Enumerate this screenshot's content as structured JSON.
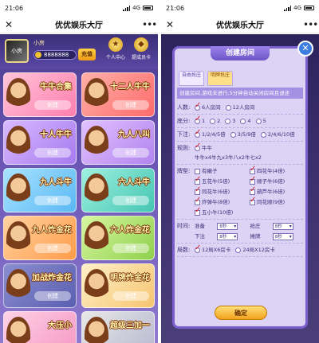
{
  "status_bar": {
    "time": "21:06",
    "network": "4G"
  },
  "wechat": {
    "close_icon": "close-icon",
    "title": "优优娱乐大厅",
    "more_icon": "more-icon"
  },
  "left": {
    "user": {
      "name": "小房",
      "avatar_text": "小房",
      "coins": "8888888",
      "recharge_label": "充值"
    },
    "top_icons": [
      {
        "icon": "trophy-icon",
        "label": "个人中心"
      },
      {
        "icon": "bag-icon",
        "label": "提成员卡"
      }
    ],
    "games": [
      {
        "name": "牛牛合集",
        "btn": "创建",
        "color": "c-pink"
      },
      {
        "name": "十二人牛牛",
        "btn": "创建",
        "color": "c-red"
      },
      {
        "name": "十人牛牛",
        "btn": "创建",
        "color": "c-purple"
      },
      {
        "name": "九人八叫",
        "btn": "创建",
        "color": "c-violet"
      },
      {
        "name": "九人斗牛",
        "btn": "创建",
        "color": "c-blue"
      },
      {
        "name": "六人斗牛",
        "btn": "创建",
        "color": "c-teal"
      },
      {
        "name": "九人炸金花",
        "btn": "创建",
        "color": "c-orange"
      },
      {
        "name": "六人炸金花",
        "btn": "创建",
        "color": "c-lime"
      },
      {
        "name": "加战炸金花",
        "btn": "创建",
        "color": "c-dark"
      },
      {
        "name": "明牌炸金花",
        "btn": "创建",
        "color": "c-cream"
      },
      {
        "name": "大压小",
        "btn": "",
        "color": "c-pinkb"
      },
      {
        "name": "超级三加一",
        "btn": "",
        "color": "c-gray"
      }
    ]
  },
  "right": {
    "modal_title": "创建房间",
    "tabs": [
      "自由抢庄",
      "明牌抢庄"
    ],
    "notice": "创建房间,游戏未进行,5分钟自动关闭房间且退还",
    "rows": {
      "players": {
        "label": "人数:",
        "opts": [
          "6人房间",
          "12人房间"
        ]
      },
      "base": {
        "label": "底分:",
        "opts": [
          "1",
          "2",
          "3",
          "4",
          "5"
        ]
      },
      "bet": {
        "label": "下注:",
        "opts": [
          "1/2/4/5倍",
          "3/5/9倍",
          "2/4/6/10倍"
        ]
      },
      "rule": {
        "label": "规则:",
        "opt": "牛牛",
        "desc": "牛牛x4牛九x3牛八x2牛七x2"
      },
      "cards": {
        "label": "牌型:",
        "opts": [
          "有癞子",
          "四花牛(4倍)",
          "五花牛(5倍)",
          "顺子牛(6倍)",
          "同花牛(6倍)",
          "葫芦牛(6倍)",
          "炸弹牛(8倍)",
          "同花顺(9倍)",
          "五小牛(10倍)"
        ]
      },
      "time": {
        "label": "时间:",
        "prep": "准备",
        "prep_val": "8秒",
        "grab": "抢庄",
        "grab_val": "8秒",
        "bet": "下注",
        "bet_val": "8秒",
        "show": "摊牌",
        "show_val": "8秒"
      },
      "rounds": {
        "label": "局数:",
        "opts": [
          "12局X6房卡",
          "24局X12房卡"
        ]
      }
    },
    "confirm": "确定"
  }
}
